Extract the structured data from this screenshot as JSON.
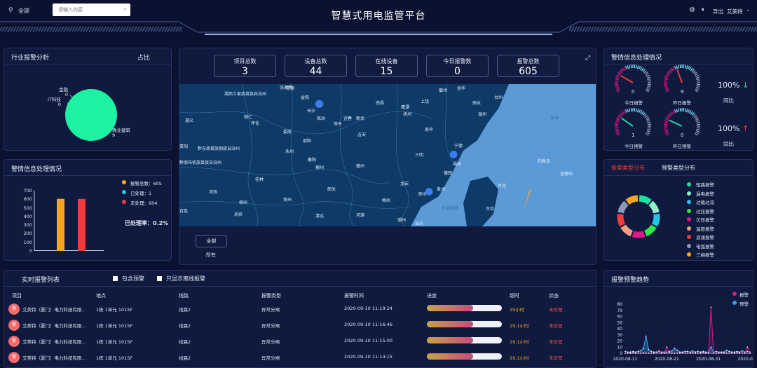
{
  "header": {
    "title": "智慧式用电监管平台",
    "location": "全部",
    "search_placeholder": "请输入内容",
    "export": "导出",
    "user": "艾美特"
  },
  "industry": {
    "title": "行业报警分析",
    "ratio_label": "占比",
    "slices": [
      {
        "name": "金融",
        "value": "0"
      },
      {
        "name": "IT科技",
        "value": "0"
      },
      {
        "name": "商业建筑",
        "value": "9"
      }
    ]
  },
  "alarm_handling": {
    "title": "警情信息处理情况",
    "ylim": [
      0,
      700
    ],
    "yticks": [
      "700",
      "600",
      "500",
      "400",
      "300",
      "200",
      "100",
      "0"
    ],
    "bars": [
      {
        "name": "报警总数",
        "value": 605,
        "color": "#f5a623"
      },
      {
        "name": "已处理",
        "value": 1,
        "color": "#22c8e8"
      },
      {
        "name": "未处理",
        "value": 604,
        "color": "#ef3b3b"
      }
    ],
    "legend": [
      "报警总数：605",
      "已处理：1",
      "未处理：604"
    ],
    "rate_label": "已处理率：",
    "rate_value": "0.2%"
  },
  "kpis": [
    {
      "label": "项目总数",
      "value": "3"
    },
    {
      "label": "设备总数",
      "value": "44"
    },
    {
      "label": "在线设备",
      "value": "15"
    },
    {
      "label": "今日报警数",
      "value": "0"
    },
    {
      "label": "报警总数",
      "value": "605"
    }
  ],
  "map": {
    "filter_button": "全部",
    "filter_caption": "所有",
    "labels": [
      "张家界",
      "常德",
      "益阳",
      "湘西土家族苗族自治州",
      "长沙",
      "株洲",
      "宜春",
      "新余",
      "南昌",
      "鹰潭",
      "上饶",
      "衢州",
      "金华",
      "台州",
      "丽水",
      "温州",
      "怀化",
      "遵义",
      "铜仁",
      "娄底",
      "萍乡",
      "吉安",
      "抚州",
      "南平",
      "宁德",
      "邵阳",
      "衡阳",
      "永州",
      "黔东南苗族侗族自治州",
      "贵阳",
      "三明",
      "福州",
      "莆田",
      "黔南布依族苗族自治州",
      "郴州",
      "赣州",
      "桂林",
      "龙岩",
      "泉州",
      "漳州",
      "台湾海峡",
      "台北",
      "台中",
      "河池",
      "柳州",
      "贺州",
      "韶关",
      "梅州",
      "百色",
      "来宾",
      "清远",
      "河源",
      "潮州",
      "汕头",
      "东海",
      "钓鱼岛",
      "赤尾屿"
    ]
  },
  "alarm_status": {
    "title": "警情信息处理情况",
    "gauges": [
      {
        "label": "今日报警",
        "value": "0"
      },
      {
        "label": "昨日报警",
        "value": "9"
      },
      {
        "label": "今日预警",
        "value": "1"
      },
      {
        "label": "昨日预警",
        "value": "0"
      }
    ],
    "compare": [
      {
        "value": "100%",
        "arrow": "↓",
        "label": "同比"
      },
      {
        "value": "100%",
        "arrow": "↑",
        "label": "同比"
      }
    ]
  },
  "type_dist": {
    "tab_active": "报警类型分布",
    "tab_other": "预警类型分布",
    "items": [
      {
        "name": "短路报警",
        "color": "#1ee3a0"
      },
      {
        "name": "漏电报警",
        "color": "#8ef0c8"
      },
      {
        "name": "过载过流",
        "color": "#22c8e8"
      },
      {
        "name": "过压报警",
        "color": "#2ee84a"
      },
      {
        "name": "欠压报警",
        "color": "#e0168a"
      },
      {
        "name": "温度报警",
        "color": "#f0a080"
      },
      {
        "name": "浪涌报警",
        "color": "#ef3b3b"
      },
      {
        "name": "电弧报警",
        "color": "#8a9aba"
      },
      {
        "name": "三相报警",
        "color": "#f5a623"
      }
    ]
  },
  "realtime": {
    "title": "实时报警列表",
    "opt1": "包含预警",
    "opt2": "只显示离线报警",
    "columns": [
      "项目",
      "地点",
      "线路",
      "报警类型",
      "报警时间",
      "进度",
      "超时",
      "状态"
    ],
    "rows": [
      {
        "icon": "警",
        "project": "艾美特（厦门）电力科技有限...",
        "location": "1栋 1单元 1015F",
        "line": "线路2",
        "type": "异常分闸",
        "time": "2020-09-10 11:19:24",
        "progress": 0.62,
        "overtime": "29小时",
        "status": "未处理"
      },
      {
        "icon": "警",
        "project": "艾美特（厦门）电力科技有限...",
        "location": "1栋 1单元 1015F",
        "line": "线路2",
        "type": "异常分闸",
        "time": "2020-09-10 11:16:46",
        "progress": 0.62,
        "overtime": "29.1小时",
        "status": "未处理"
      },
      {
        "icon": "警",
        "project": "艾美特（厦门）电力科技有限...",
        "location": "1栋 1单元 1015F",
        "line": "线路2",
        "type": "异常分闸",
        "time": "2020-09-10 11:15:00",
        "progress": 0.62,
        "overtime": "29.1小时",
        "status": "未处理"
      },
      {
        "icon": "警",
        "project": "艾美特（厦门）电力科技有限...",
        "location": "1栋 1单元 1015F",
        "line": "线路2",
        "type": "异常分闸",
        "time": "2020-09-10 11:14:15",
        "progress": 0.62,
        "overtime": "29.1小时",
        "status": "未处理"
      }
    ]
  },
  "trend": {
    "title": "报警预警趋势",
    "legend": [
      {
        "name": "报警",
        "color": "#e0168a"
      },
      {
        "name": "预警",
        "color": "#35a6f5"
      }
    ],
    "yticks": [
      "80",
      "70",
      "60",
      "50",
      "40",
      "30",
      "20",
      "10",
      "0"
    ],
    "xticks": [
      "2020-08-11",
      "2020-08-21",
      "2020-08-31",
      "2020-09-10"
    ]
  },
  "chart_data": [
    {
      "type": "bar",
      "title": "警情信息处理情况",
      "categories": [
        "报警总数",
        "已处理",
        "未处理"
      ],
      "values": [
        605,
        1,
        604
      ],
      "ylim": [
        0,
        700
      ]
    },
    {
      "type": "line",
      "title": "报警预警趋势",
      "x": [
        "2020-08-11",
        "2020-08-21",
        "2020-08-31",
        "2020-09-10"
      ],
      "ylim": [
        0,
        80
      ],
      "series": [
        {
          "name": "报警",
          "values": [
            0,
            0,
            0,
            1,
            0,
            0,
            0,
            1,
            0,
            0,
            0,
            0,
            2,
            4,
            0,
            0,
            10,
            2,
            0,
            0,
            0,
            0,
            1,
            0,
            0,
            0,
            1,
            0,
            0,
            0,
            2,
            0,
            0,
            75,
            0,
            0,
            0,
            1,
            0,
            0,
            0,
            0,
            0,
            1,
            0,
            0,
            0,
            10,
            0
          ]
        },
        {
          "name": "预警",
          "values": [
            3,
            2,
            2,
            3,
            2,
            3,
            4,
            8,
            28,
            6,
            3,
            2,
            2,
            3,
            2,
            2,
            2,
            3,
            4,
            8,
            5,
            2,
            2,
            3,
            3,
            2,
            4,
            2,
            3,
            2,
            3,
            2,
            2,
            10,
            2,
            3,
            2,
            2,
            2,
            5,
            3,
            2,
            2,
            3,
            2,
            4,
            2,
            3,
            2
          ]
        }
      ]
    }
  ]
}
